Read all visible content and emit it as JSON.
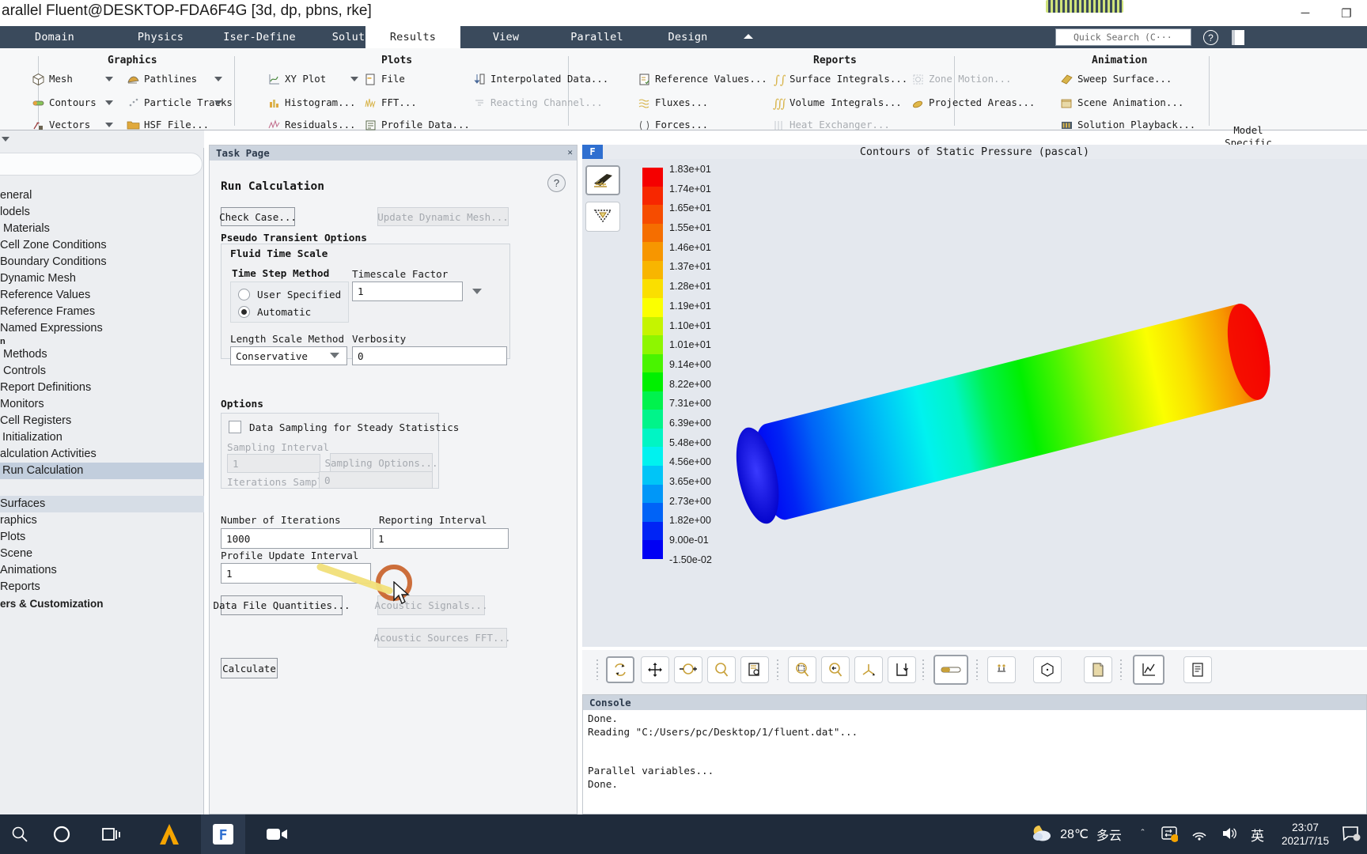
{
  "window": {
    "title": "arallel Fluent@DESKTOP-FDA6F4G  [3d, dp, pbns, rke]",
    "minimize": "─",
    "maximize": "❐",
    "restore": "❐"
  },
  "ribbon": {
    "tabs": [
      {
        "label": "Domain",
        "active": false
      },
      {
        "label": "Physics",
        "active": false
      },
      {
        "label": "Iser-Define",
        "active": false
      },
      {
        "label": "Solution",
        "active": false
      },
      {
        "label": "Results",
        "active": true
      },
      {
        "label": "View",
        "active": false
      },
      {
        "label": "Parallel",
        "active": false
      },
      {
        "label": "Design",
        "active": false
      }
    ],
    "quick_search_placeholder": "Quick Search (C···",
    "groups": [
      {
        "title": "Graphics"
      },
      {
        "title": "Plots"
      },
      {
        "title": "Reports"
      },
      {
        "title": "Animation"
      }
    ],
    "graphics_items": [
      {
        "label": "Mesh",
        "icon": "mesh-cube-icon",
        "disabled": false,
        "caret": true
      },
      {
        "label": "Contours",
        "icon": "contours-icon",
        "disabled": false,
        "caret": true
      },
      {
        "label": "Vectors",
        "icon": "vectors-icon",
        "disabled": false,
        "caret": true
      },
      {
        "label": "Pathlines",
        "icon": "pathlines-icon",
        "disabled": false,
        "caret": true
      },
      {
        "label": "Particle Tracks",
        "icon": "particle-tracks-icon",
        "disabled": false,
        "caret": true
      },
      {
        "label": "HSF File...",
        "icon": "folder-icon",
        "disabled": false,
        "caret": false
      }
    ],
    "plots_items": [
      {
        "label": "XY Plot",
        "icon": "xy-plot-icon",
        "disabled": false,
        "caret": true
      },
      {
        "label": "Histogram...",
        "icon": "histogram-icon",
        "disabled": false,
        "caret": false
      },
      {
        "label": "Residuals...",
        "icon": "residuals-icon",
        "disabled": false,
        "caret": false
      },
      {
        "label": "File",
        "icon": "file-icon",
        "disabled": false,
        "caret": false
      },
      {
        "label": "FFT...",
        "icon": "fft-icon",
        "disabled": false,
        "caret": false
      },
      {
        "label": "Profile Data...",
        "icon": "profile-data-icon",
        "disabled": false,
        "caret": false
      },
      {
        "label": "Interpolated Data...",
        "icon": "interpolated-data-icon",
        "disabled": false,
        "caret": false
      },
      {
        "label": "Reacting Channel...",
        "icon": "reacting-channel-icon",
        "disabled": true,
        "caret": false
      }
    ],
    "reports_items": [
      {
        "label": "Reference Values...",
        "icon": "reference-values-icon",
        "disabled": false
      },
      {
        "label": "Fluxes...",
        "icon": "fluxes-icon",
        "disabled": false
      },
      {
        "label": "Forces...",
        "icon": "forces-icon",
        "disabled": false
      },
      {
        "label": "Surface Integrals...",
        "icon": "surface-integrals-icon",
        "disabled": false
      },
      {
        "label": "Volume Integrals...",
        "icon": "volume-integrals-icon",
        "disabled": false
      },
      {
        "label": "Heat Exchanger...",
        "icon": "heat-exchanger-icon",
        "disabled": true
      },
      {
        "label": "Zone Motion...",
        "icon": "zone-motion-icon",
        "disabled": true
      },
      {
        "label": "Projected Areas...",
        "icon": "projected-areas-icon",
        "disabled": false
      }
    ],
    "animation_items": [
      {
        "label": "Sweep Surface...",
        "icon": "sweep-surface-icon",
        "disabled": false
      },
      {
        "label": "Scene Animation...",
        "icon": "scene-animation-icon",
        "disabled": false
      },
      {
        "label": "Solution Playback...",
        "icon": "solution-playback-icon",
        "disabled": false
      }
    ],
    "model_specific_line1": "Model",
    "model_specific_line2": "Specific"
  },
  "tree": {
    "items": [
      {
        "label": "eneral",
        "state": "normal"
      },
      {
        "label": "lodels",
        "state": "normal"
      },
      {
        "label": "Materials",
        "state": "normal"
      },
      {
        "label": "Cell Zone Conditions",
        "state": "normal"
      },
      {
        "label": "Boundary Conditions",
        "state": "normal"
      },
      {
        "label": "Dynamic Mesh",
        "state": "normal"
      },
      {
        "label": "Reference Values",
        "state": "normal"
      },
      {
        "label": "Reference Frames",
        "state": "normal"
      },
      {
        "label": "Named Expressions",
        "state": "normal"
      },
      {
        "label": "n",
        "state": "tiny"
      },
      {
        "label": "Methods",
        "state": "normal"
      },
      {
        "label": "Controls",
        "state": "normal"
      },
      {
        "label": "Report Definitions",
        "state": "normal"
      },
      {
        "label": "Monitors",
        "state": "normal"
      },
      {
        "label": "Cell Registers",
        "state": "normal"
      },
      {
        "label": "Initialization",
        "state": "normal"
      },
      {
        "label": "alculation Activities",
        "state": "normal"
      },
      {
        "label": "Run Calculation",
        "state": "selected"
      },
      {
        "label": "",
        "state": "normal"
      },
      {
        "label": "Surfaces",
        "state": "band"
      },
      {
        "label": "raphics",
        "state": "normal"
      },
      {
        "label": "Plots",
        "state": "normal"
      },
      {
        "label": "Scene",
        "state": "normal"
      },
      {
        "label": "Animations",
        "state": "normal"
      },
      {
        "label": "Reports",
        "state": "normal"
      },
      {
        "label": "ers & Customization",
        "state": "bold"
      }
    ]
  },
  "task_page": {
    "header": "Task Page",
    "close_icon": "✕",
    "title": "Run Calculation",
    "help_icon": "?",
    "check_case_button": "Check Case...",
    "update_dynamic_mesh_button": "Update Dynamic Mesh...",
    "pseudo_transient_label": "Pseudo Transient Options",
    "fluid_time_scale_label": "Fluid Time Scale",
    "time_step_method_label": "Time Step Method",
    "radio_user_specified": "User Specified",
    "radio_automatic": "Automatic",
    "selected_time_step_method": "Automatic",
    "timescale_factor_label": "Timescale Factor",
    "timescale_factor_value": "1",
    "length_scale_method_label": "Length Scale Method",
    "length_scale_method_value": "Conservative",
    "verbosity_label": "Verbosity",
    "verbosity_value": "0",
    "options_label": "Options",
    "data_sampling_label": "Data Sampling for Steady Statistics",
    "data_sampling_checked": false,
    "sampling_interval_label": "Sampling Interval",
    "sampling_interval_value": "1",
    "sampling_options_button": "Sampling Options...",
    "iterations_sampled_label": "Iterations Sampled",
    "iterations_sampled_value": "0",
    "number_of_iterations_label": "Number of Iterations",
    "number_of_iterations_value": "1000",
    "reporting_interval_label": "Reporting Interval",
    "reporting_interval_value": "1",
    "profile_update_interval_label": "Profile Update Interval",
    "profile_update_interval_value": "1",
    "data_file_quantities_button": "Data File Quantities...",
    "acoustic_signals_button": "Acoustic Signals...",
    "acoustic_sources_fft_button": "Acoustic Sources FFT...",
    "calculate_button": "Calculate"
  },
  "graphics": {
    "tab_label": "F",
    "title": "Contours of Static Pressure (pascal)",
    "side_buttons": [
      {
        "icon": "mesh-display-icon",
        "selected": true
      },
      {
        "icon": "light-source-icon",
        "selected": false
      }
    ],
    "colorbar_labels": [
      "1.83e+01",
      "1.74e+01",
      "1.65e+01",
      "1.55e+01",
      "1.46e+01",
      "1.37e+01",
      "1.28e+01",
      "1.19e+01",
      "1.10e+01",
      "1.01e+01",
      "9.14e+00",
      "8.22e+00",
      "7.31e+00",
      "6.39e+00",
      "5.48e+00",
      "4.56e+00",
      "3.65e+00",
      "2.73e+00",
      "1.82e+00",
      "9.00e-01",
      "-1.50e-02"
    ],
    "colorbar_colors": [
      "#f50000",
      "#f72700",
      "#f64c00",
      "#f56e00",
      "#f79600",
      "#f8b500",
      "#fadf00",
      "#fbff00",
      "#c5f400",
      "#8ef600",
      "#49f400",
      "#00f000",
      "#00f24d",
      "#00f48a",
      "#00f5c4",
      "#00f2ef",
      "#00c5f7",
      "#0097f8",
      "#0063f7",
      "#0024f5",
      "#0000f4"
    ]
  },
  "chart_data": {
    "type": "heatmap",
    "title": "Contours of Static Pressure (pascal)",
    "ylabel": "Static Pressure (pascal)",
    "colorbar_ticks": [
      18.3,
      17.4,
      16.5,
      15.5,
      14.6,
      13.7,
      12.8,
      11.9,
      11.0,
      10.1,
      9.14,
      8.22,
      7.31,
      6.39,
      5.48,
      4.56,
      3.65,
      2.73,
      1.82,
      0.9,
      -0.015
    ],
    "range": [
      -0.015,
      18.3
    ],
    "units": "pascal",
    "geometry": "cylindrical pipe, axial pressure gradient, high at right (red) to low at left (blue)"
  },
  "view_toolbar": {
    "buttons": [
      {
        "icon": "rotate-view-icon",
        "selected": true
      },
      {
        "icon": "pan-view-icon",
        "selected": false
      },
      {
        "icon": "zoom-in-out-icon",
        "selected": false
      },
      {
        "icon": "magnifier-icon",
        "selected": false
      },
      {
        "icon": "fit-to-window-icon",
        "selected": false
      },
      {
        "icon": "zoom-to-region-icon",
        "selected": false
      },
      {
        "icon": "zoom-out-icon",
        "selected": false
      },
      {
        "icon": "axis-triad-icon",
        "selected": false
      },
      {
        "icon": "save-view-icon",
        "selected": false
      },
      {
        "icon": "ruler-probe-icon",
        "selected": true
      },
      {
        "icon": "annotate-icon",
        "selected": false
      },
      {
        "icon": "bounding-box-icon",
        "selected": false
      },
      {
        "icon": "copy-screenshot-icon",
        "selected": false
      },
      {
        "icon": "chart-plot-icon",
        "selected": true
      },
      {
        "icon": "report-icon",
        "selected": false
      }
    ]
  },
  "console": {
    "header": "Console",
    "text": "Done.\nReading \"C:/Users/pc/Desktop/1/fluent.dat\"...\n\n\nParallel variables...\nDone."
  },
  "taskbar": {
    "items": [
      {
        "icon": "search-icon",
        "name": "search"
      },
      {
        "icon": "cortana-icon",
        "name": "cortana"
      },
      {
        "icon": "task-view-icon",
        "name": "task-view"
      },
      {
        "icon": "ansys-icon",
        "name": "ansys"
      },
      {
        "icon": "fluent-icon",
        "name": "fluent",
        "active": true
      },
      {
        "icon": "camera-recorder-icon",
        "name": "recorder"
      }
    ],
    "weather_temp": "28℃",
    "weather_desc": "多云",
    "chevron_up": "＾",
    "ime_label": "英",
    "clock_time": "23:07",
    "clock_date": "2021/7/15"
  },
  "annotation": {
    "circle_color": "#c9622a",
    "arrow_color": "#f2e07a"
  }
}
